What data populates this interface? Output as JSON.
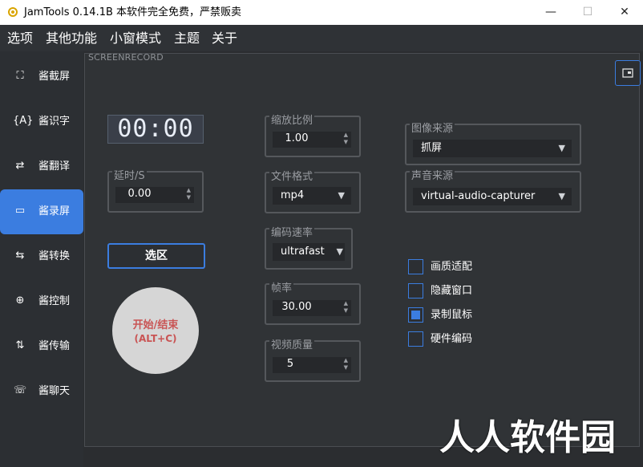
{
  "window": {
    "title": "JamTools 0.14.1B 本软件完全免费，严禁贩卖",
    "minimize": "—",
    "maximize": "☐",
    "close": "✕"
  },
  "menu": [
    "选项",
    "其他功能",
    "小窗模式",
    "主题",
    "关于"
  ],
  "sidebar": {
    "items": [
      {
        "label": "酱截屏",
        "icon": "crop-icon",
        "glyph": "⛶"
      },
      {
        "label": "酱识字",
        "icon": "text-recognition-icon",
        "glyph": "{A}"
      },
      {
        "label": "酱翻译",
        "icon": "translate-icon",
        "glyph": "⇄"
      },
      {
        "label": "酱录屏",
        "icon": "video-camera-icon",
        "glyph": "▭"
      },
      {
        "label": "酱转换",
        "icon": "convert-icon",
        "glyph": "⇆"
      },
      {
        "label": "酱控制",
        "icon": "control-icon",
        "glyph": "⊕"
      },
      {
        "label": "酱传输",
        "icon": "transfer-icon",
        "glyph": "⇅"
      },
      {
        "label": "酱聊天",
        "icon": "chat-icon",
        "glyph": "☏"
      }
    ],
    "active_index": 3
  },
  "panel": {
    "title": "SCREENRECORD"
  },
  "timer": "00:00",
  "delay": {
    "caption": "延时/S",
    "value": "0.00"
  },
  "select_area_label": "选区",
  "start": {
    "line1": "开始/结束",
    "line2": "(ALT+C)"
  },
  "scale": {
    "caption": "缩放比例",
    "value": "1.00"
  },
  "format": {
    "caption": "文件格式",
    "value": "mp4"
  },
  "encode_speed": {
    "caption": "编码速率",
    "value": "ultrafast"
  },
  "fps": {
    "caption": "帧率",
    "value": "30.00"
  },
  "quality": {
    "caption": "视频质量",
    "value": "5"
  },
  "image_source": {
    "caption": "图像来源",
    "value": "抓屏"
  },
  "audio_source": {
    "caption": "声音来源",
    "value": "virtual-audio-capturer"
  },
  "options": [
    {
      "label": "画质适配",
      "checked": false
    },
    {
      "label": "隐藏窗口",
      "checked": false
    },
    {
      "label": "录制鼠标",
      "checked": true
    },
    {
      "label": "硬件编码",
      "checked": false
    }
  ],
  "watermark": "人人软件园",
  "accent": "#3b7de0"
}
